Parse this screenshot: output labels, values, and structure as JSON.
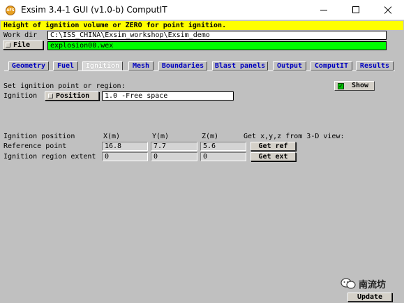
{
  "window": {
    "icon_text": "AFS",
    "title": "Exsim 3.4-1 GUI (v1.0-b) ComputIT"
  },
  "hint": "Height of ignition volume or ZERO for point ignition.",
  "workdir": {
    "label": "Work dir",
    "value": "C:\\ISS_CHINA\\Exsim_workshop\\Exsim_demo"
  },
  "file": {
    "button_label": "File",
    "value": "explosion00.wex"
  },
  "tabs": [
    {
      "label": "Geometry",
      "active": false
    },
    {
      "label": "Fuel",
      "active": false
    },
    {
      "label": "Ignition",
      "active": true
    },
    {
      "label": "Mesh",
      "active": false
    },
    {
      "label": "Boundaries",
      "active": false
    },
    {
      "label": "Blast panels",
      "active": false
    },
    {
      "label": "Output",
      "active": false
    },
    {
      "label": "ComputIT",
      "active": false
    },
    {
      "label": "Results",
      "active": false
    }
  ],
  "ignition": {
    "set_label": "Set ignition point or region:",
    "show_label": "Show",
    "show_checked": true,
    "ignition_label": "Ignition",
    "mode_button": "Position",
    "mode_value": "1.0  -Free space"
  },
  "table": {
    "title": "Ignition position",
    "col_x": "X(m)",
    "col_y": "Y(m)",
    "col_z": "Z(m)",
    "get_hint": "Get x,y,z from 3-D view:",
    "rows": [
      {
        "label": "Reference point",
        "x": "16.8",
        "y": "7.7",
        "z": "5.6",
        "button": "Get ref"
      },
      {
        "label": "Ignition region extent",
        "x": "0",
        "y": "0",
        "z": "0",
        "button": "Get ext"
      }
    ]
  },
  "footer": {
    "watermark": "南流坊",
    "update_label": "Update"
  }
}
